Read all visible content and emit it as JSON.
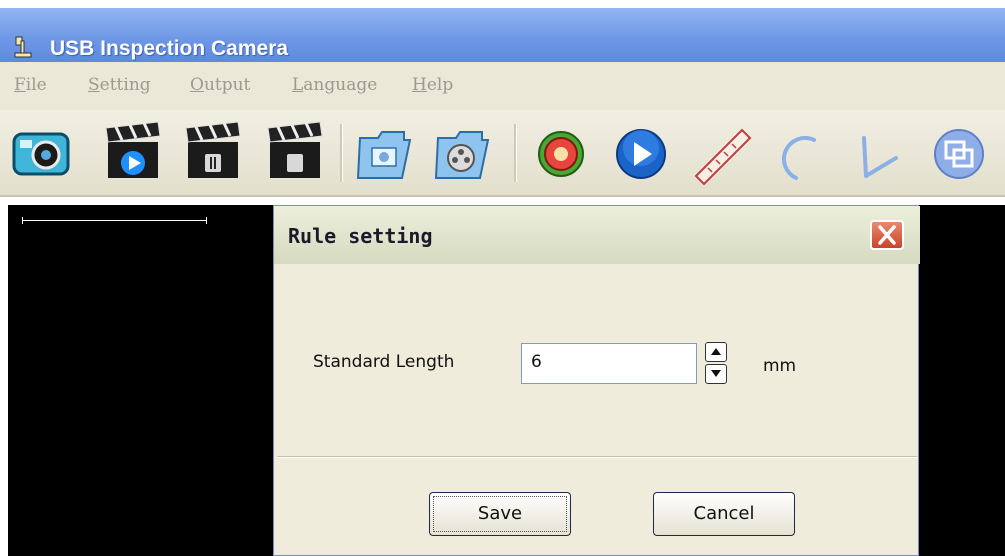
{
  "app": {
    "title": "USB Inspection Camera"
  },
  "menu": [
    {
      "accel": "F",
      "rest": "ile"
    },
    {
      "accel": "S",
      "rest": "etting"
    },
    {
      "accel": "O",
      "rest": "utput"
    },
    {
      "accel": "L",
      "rest": "anguage"
    },
    {
      "accel": "H",
      "rest": "elp"
    }
  ],
  "toolbar": {
    "buttons": [
      {
        "icon": "camera-icon"
      },
      {
        "icon": "video-record-icon"
      },
      {
        "icon": "video-pause-icon"
      },
      {
        "icon": "video-stop-icon"
      },
      {
        "icon": "photo-folder-icon"
      },
      {
        "icon": "video-folder-icon"
      },
      {
        "icon": "settings-gear-icon"
      },
      {
        "icon": "play-icon"
      },
      {
        "icon": "ruler-icon"
      },
      {
        "icon": "arc-icon"
      },
      {
        "icon": "angle-icon"
      },
      {
        "icon": "overlay-icon"
      }
    ]
  },
  "dialog": {
    "title": "Rule setting",
    "field_label": "Standard Length",
    "field_value": "6",
    "unit": "mm",
    "save_label": "Save",
    "cancel_label": "Cancel"
  },
  "colors": {
    "titlebar": "#6f98e6",
    "menubar": "#ebe8d8",
    "dialog_bg": "#efecdc",
    "close_red": "#c9442a",
    "viewport": "#000000"
  }
}
